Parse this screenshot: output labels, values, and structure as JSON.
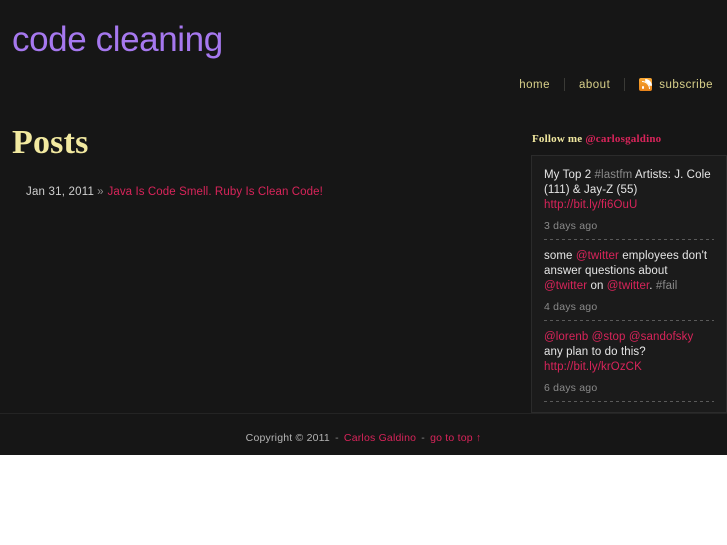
{
  "site": {
    "title": "code cleaning",
    "title_color": "#a678ef",
    "background": "#161616"
  },
  "nav": {
    "home_label": "home",
    "about_label": "about",
    "subscribe_label": "subscribe",
    "rss_icon": "rss-icon",
    "link_color": "#d8d08a"
  },
  "main": {
    "heading": "Posts",
    "heading_color": "#f2e9a0",
    "posts": [
      {
        "date": "Jan 31, 2011",
        "separator": "»",
        "title": "Java Is Code Smell. Ruby Is Clean Code!",
        "link_color": "#d8245a"
      }
    ]
  },
  "twitter": {
    "follow_label": "Follow me",
    "handle": "@carlosgaldino",
    "tweets": [
      {
        "parts": [
          {
            "text": "My Top 2 ",
            "type": "plain"
          },
          {
            "text": "#lastfm",
            "type": "tag"
          },
          {
            "text": " Artists: J. Cole (111) & Jay-Z (55) ",
            "type": "plain"
          },
          {
            "text": "http://bit.ly/fi6OuU",
            "type": "link"
          }
        ],
        "time": "3 days ago"
      },
      {
        "parts": [
          {
            "text": "some ",
            "type": "plain"
          },
          {
            "text": "@twitter",
            "type": "link"
          },
          {
            "text": " employees don't answer questions about ",
            "type": "plain"
          },
          {
            "text": "@twitter",
            "type": "link"
          },
          {
            "text": " on ",
            "type": "plain"
          },
          {
            "text": "@twitter",
            "type": "link"
          },
          {
            "text": ". ",
            "type": "plain"
          },
          {
            "text": "#fail",
            "type": "tag"
          }
        ],
        "time": "4 days ago"
      },
      {
        "parts": [
          {
            "text": "@lorenb",
            "type": "link"
          },
          {
            "text": " ",
            "type": "plain"
          },
          {
            "text": "@stop",
            "type": "link"
          },
          {
            "text": " ",
            "type": "plain"
          },
          {
            "text": "@sandofsky",
            "type": "link"
          },
          {
            "text": " any plan to do this? ",
            "type": "plain"
          },
          {
            "text": "http://bit.ly/krOzCK",
            "type": "link"
          }
        ],
        "time": "6 days ago"
      }
    ]
  },
  "footer": {
    "copyright": "Copyright © 2011",
    "dash1": "-",
    "author": "Carlos Galdino",
    "dash2": "-",
    "go_to_top": "go to top ↑"
  }
}
